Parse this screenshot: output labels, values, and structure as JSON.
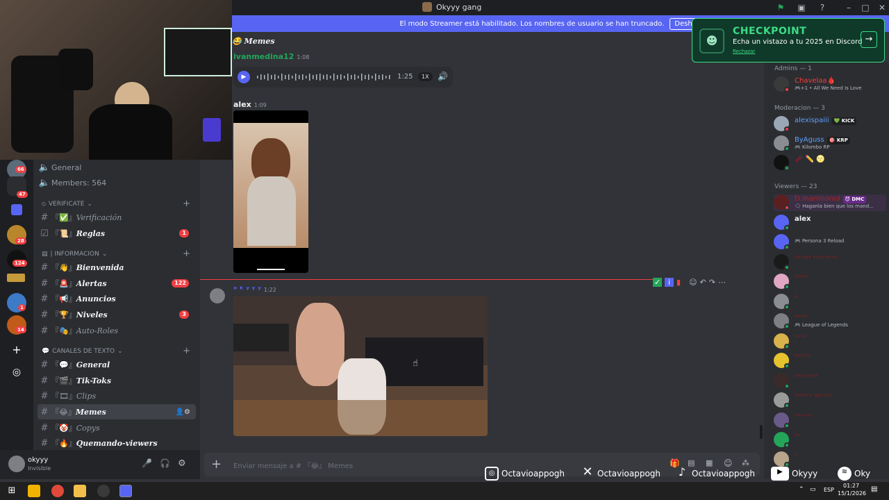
{
  "titlebar": {
    "title": "Okyyy gang"
  },
  "banner": {
    "text": "El modo Streamer está habilitado. Los nombres de usuario se han truncado.",
    "button": "Deshabilitar"
  },
  "checkpoint": {
    "title": "CHECKPOINT",
    "subtitle": "Echa un vistazo a tu 2025 en Discord",
    "dismiss": "Rechazar"
  },
  "rail": {
    "badges": [
      "66",
      "47",
      "28",
      "124",
      "1",
      "14"
    ]
  },
  "channels": {
    "top": [
      {
        "label": "General",
        "icon": "speaker-icon"
      },
      {
        "label": "Members: 564",
        "icon": "speaker-icon"
      }
    ],
    "categories": [
      {
        "label": "VERIFICATE"
      },
      {
        "label": "| INFORMACION"
      },
      {
        "label": "CANALES DE TEXTO"
      }
    ],
    "items": [
      {
        "prefix": "『✅』",
        "label": "Verificación",
        "dim": true
      },
      {
        "prefix": "『📜』",
        "label": "Reglas",
        "badge": "1"
      },
      {
        "prefix": "『👋』",
        "label": "Bienvenida"
      },
      {
        "prefix": "『🚨』",
        "label": "Alertas",
        "badge": "122"
      },
      {
        "prefix": "『📢』",
        "label": "Anuncios"
      },
      {
        "prefix": "『🏆』",
        "label": "Niveles",
        "badge": "3"
      },
      {
        "prefix": "『🎭』",
        "label": "Auto-Roles",
        "dim": true
      },
      {
        "prefix": "『💬』",
        "label": "General"
      },
      {
        "prefix": "『🎬』",
        "label": "Tik-Toks"
      },
      {
        "prefix": "『🎞』",
        "label": "Clips",
        "dim": true
      },
      {
        "prefix": "『😂』",
        "label": "Memes",
        "active": true
      },
      {
        "prefix": "『🤡』",
        "label": "Copys",
        "dim": true
      },
      {
        "prefix": "『🔥』",
        "label": "Quemando-viewers"
      }
    ]
  },
  "user": {
    "name": "okyyy",
    "status": "Invisible"
  },
  "chat": {
    "channel_title": "Memes",
    "messages": [
      {
        "author": "ivanmedina12",
        "time": "1:08",
        "audio_duration": "1:25",
        "speed": "1X"
      },
      {
        "author": "alex",
        "time": "1:09"
      },
      {
        "author": "ᵒ ᵏ ʸ ʸ ʸ",
        "time": "1:22"
      }
    ],
    "input_placeholder": "Enviar mensaje a # 『😂』 Memes"
  },
  "members": {
    "groups": [
      {
        "label": "Admins — 1"
      },
      {
        "label": "Moderacion — 3"
      },
      {
        "label": "Viewers — 23"
      }
    ],
    "list": [
      {
        "name": "Chavelaa🩸",
        "status": "🎮+1 • All We Need Is Love",
        "color": "#f23f43"
      },
      {
        "name": "alexispaiii",
        "tag": "💚 KICK",
        "color": "#5ea1ff"
      },
      {
        "name": "ByAguss",
        "tag": "🎯 KRP",
        "status": "🎮 Kilombo RP",
        "color": "#5ea1ff"
      },
      {
        "name": "🥢 ✏️ 🌝",
        "color": "#f23f43"
      },
      {
        "name": "D.marimorxd",
        "tag": "😈 DMC",
        "status": "🗨 Haganla bien que los mand...",
        "color": "#b02020"
      },
      {
        "name": "alex",
        "color": "#f2f3f5"
      },
      {
        "name": "",
        "status": "🎮 Persona 3 Reload",
        "color": "#f2f3f5"
      },
      {
        "name": "ᵈᵃᵛⁱᵍⁱᵃ ᵉˢᵖᵉʳᵃⁿᶻᵃ",
        "color": "#8a1f1f"
      },
      {
        "name": "ᵗᵉᵃᵐⁱ",
        "color": "#8a1f1f"
      },
      {
        "name": "ᵈ",
        "color": "#8a1f1f"
      },
      {
        "name": "ᵈᵃᵛⁱᵈ",
        "status": "🎮 League of Legends",
        "color": "#8a1f1f"
      },
      {
        "name": "ˡᵘᶜⁱᵃ",
        "color": "#8a1f1f"
      },
      {
        "name": "ᵇᵉᵃᵗʳⁱᶻ",
        "color": "#8a1f1f"
      },
      {
        "name": "ᵏⁱᵏᵒˢᵉⁿᵗᵉ",
        "color": "#8a1f1f"
      },
      {
        "name": "ᵐᵃʳᵗⁱⁿᵃ ᵍᵃᵛⁱᵍʳⁱᵃ",
        "color": "#8a1f1f"
      },
      {
        "name": "ᵏⁱᵏᵒⁿᵉˢ",
        "color": "#8a1f1f"
      },
      {
        "name": "ᵉᵘ",
        "color": "#8a1f1f"
      },
      {
        "name": "ᵃ",
        "color": "#8a1f1f"
      }
    ]
  },
  "socials": [
    {
      "icon": "instagram-icon",
      "label": "Octavioappogh"
    },
    {
      "icon": "x-icon",
      "label": "Octavioappogh"
    },
    {
      "icon": "tiktok-icon",
      "label": "Octavioappogh"
    },
    {
      "icon": "youtube-icon",
      "label": "Okyyy"
    },
    {
      "icon": "spotify-icon",
      "label": "Oky"
    }
  ],
  "taskbar": {
    "lang": "ESP",
    "time": "01:27",
    "date": "15/1/2026"
  }
}
